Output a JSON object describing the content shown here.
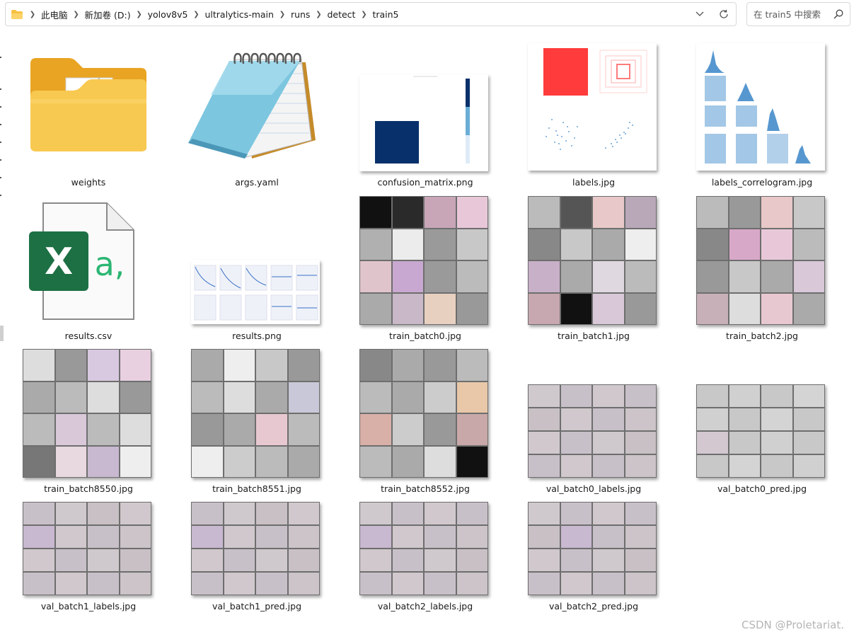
{
  "breadcrumb": [
    "此电脑",
    "新加卷 (D:)",
    "yolov8v5",
    "ultralytics-main",
    "runs",
    "detect",
    "train5"
  ],
  "search": {
    "placeholder": "在 train5 中搜索"
  },
  "files": [
    {
      "name": "weights",
      "kind": "folder"
    },
    {
      "name": "args.yaml",
      "kind": "yaml"
    },
    {
      "name": "confusion_matrix.png",
      "kind": "confusion"
    },
    {
      "name": "labels.jpg",
      "kind": "labels"
    },
    {
      "name": "labels_correlogram.jpg",
      "kind": "correlogram"
    },
    {
      "name": "results.csv",
      "kind": "csv"
    },
    {
      "name": "results.png",
      "kind": "results"
    },
    {
      "name": "train_batch0.jpg",
      "kind": "batch"
    },
    {
      "name": "train_batch1.jpg",
      "kind": "batch"
    },
    {
      "name": "train_batch2.jpg",
      "kind": "batch"
    },
    {
      "name": "train_batch8550.jpg",
      "kind": "batch"
    },
    {
      "name": "train_batch8551.jpg",
      "kind": "batch"
    },
    {
      "name": "train_batch8552.jpg",
      "kind": "batch"
    },
    {
      "name": "val_batch0_labels.jpg",
      "kind": "val"
    },
    {
      "name": "val_batch0_pred.jpg",
      "kind": "val"
    },
    {
      "name": "val_batch1_labels.jpg",
      "kind": "val"
    },
    {
      "name": "val_batch1_pred.jpg",
      "kind": "val"
    },
    {
      "name": "val_batch2_labels.jpg",
      "kind": "val"
    },
    {
      "name": "val_batch2_pred.jpg",
      "kind": "val"
    }
  ],
  "watermark": "CSDN @Proletariat.",
  "colors": {
    "folder": "#f6c142",
    "excel": "#1d7044",
    "confusion": "#08306b",
    "labels_red": "#ff3b3b",
    "scatter": "#3a86c8"
  }
}
